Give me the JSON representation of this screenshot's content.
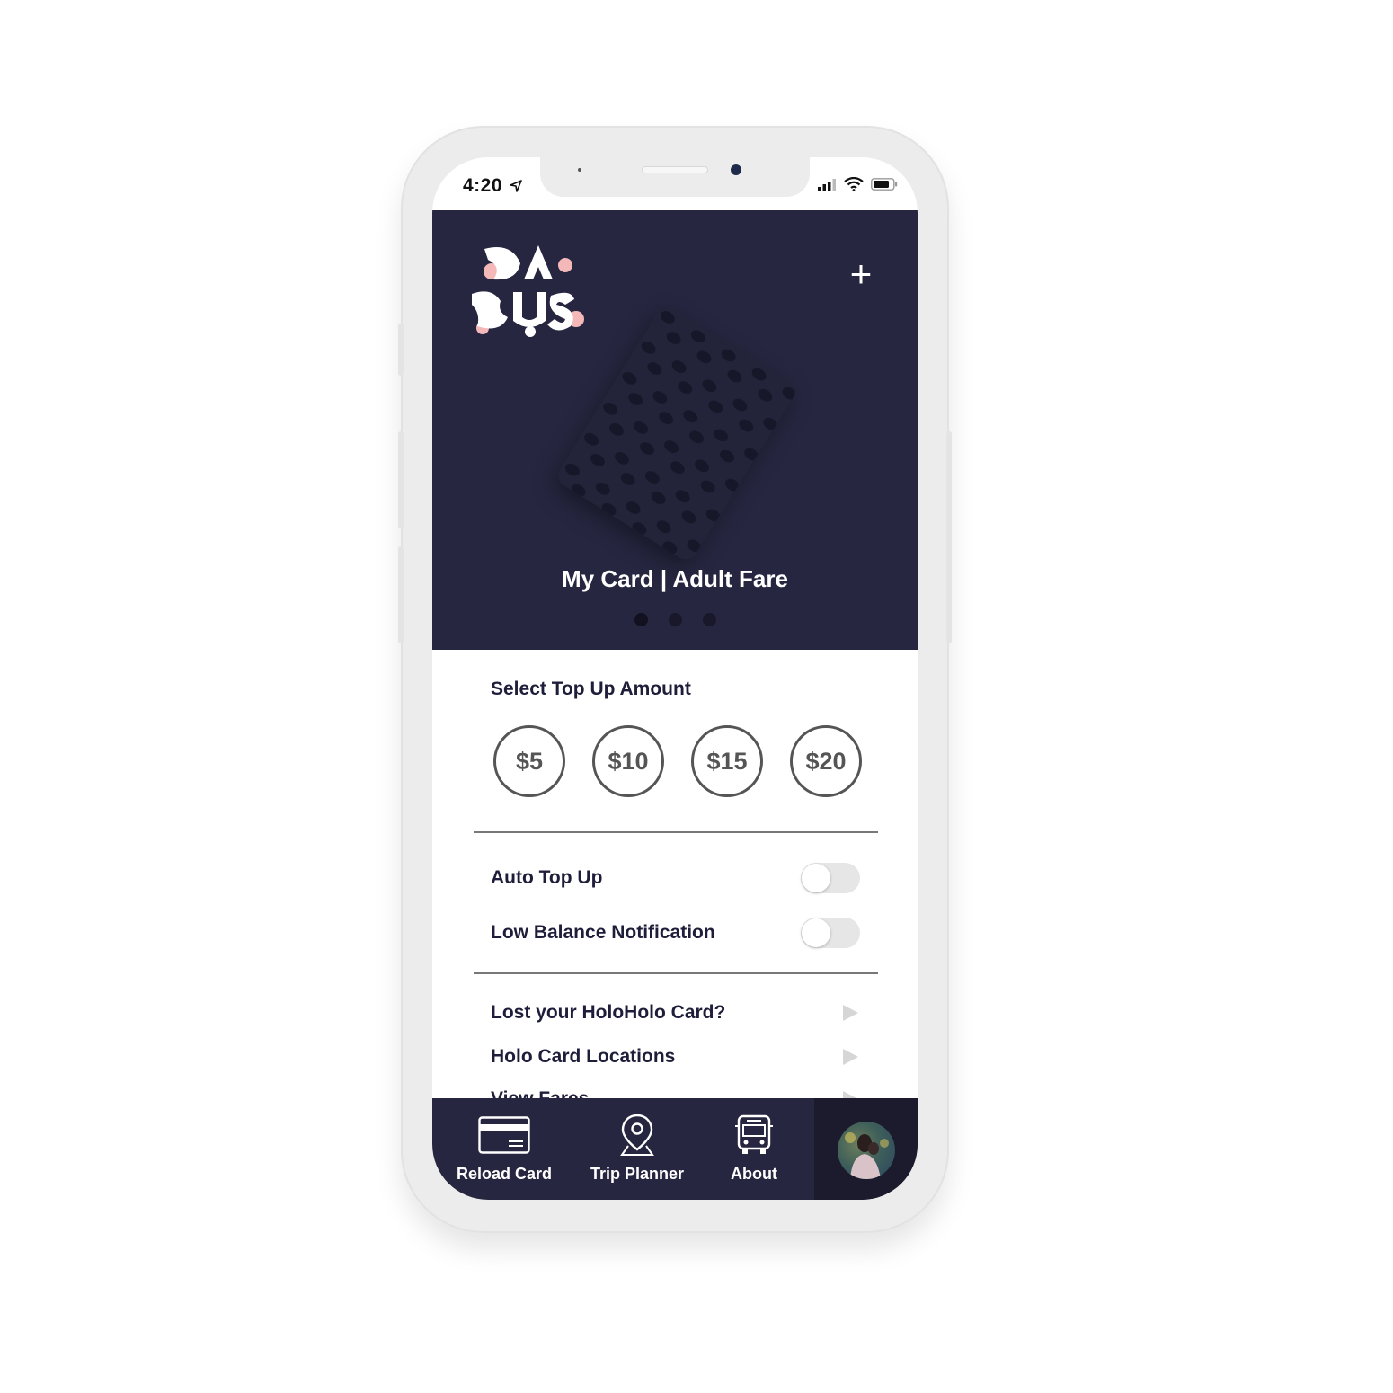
{
  "status_bar": {
    "time": "4:20"
  },
  "header": {
    "logo_text": "DA BUS",
    "add_card_label": "+",
    "card_label": "My Card | Adult Fare",
    "carousel_pages": 3,
    "carousel_active": 0
  },
  "top_up": {
    "title": "Select Top Up Amount",
    "amounts": [
      "$5",
      "$10",
      "$15",
      "$20"
    ]
  },
  "settings": {
    "auto_top_up": {
      "label": "Auto Top Up",
      "on": false
    },
    "low_balance": {
      "label": "Low Balance Notification",
      "on": false
    }
  },
  "links": [
    {
      "label": "Lost your HoloHolo Card?"
    },
    {
      "label": "Holo Card Locations"
    },
    {
      "label": "View Fares"
    }
  ],
  "tabbar": {
    "reload": "Reload Card",
    "trip": "Trip Planner",
    "about": "About"
  },
  "colors": {
    "navy": "#262640",
    "logo_pink": "#f4b8b8",
    "text_dark": "#1e1e3a"
  }
}
